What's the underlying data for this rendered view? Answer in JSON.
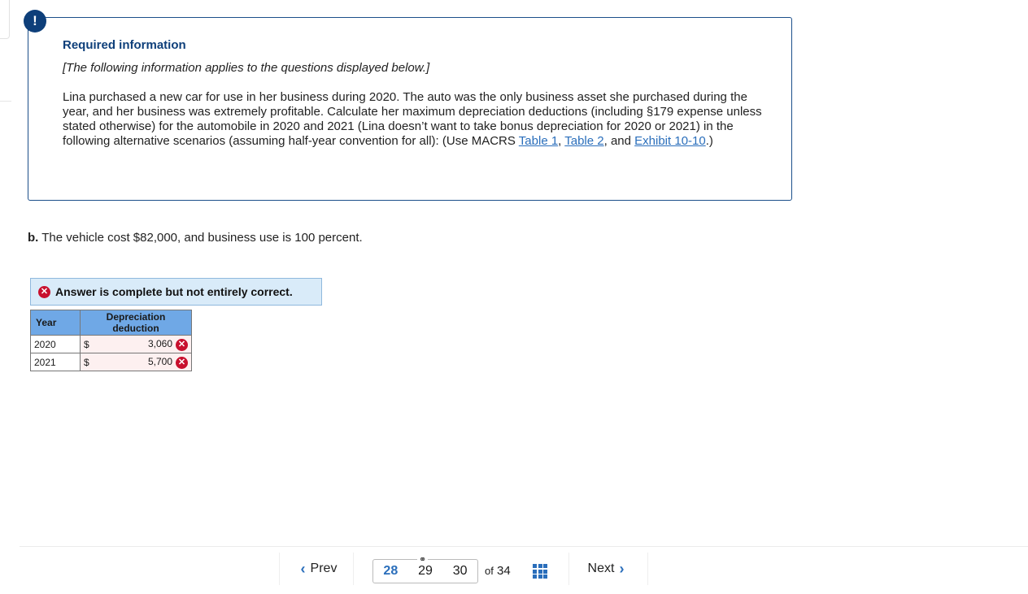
{
  "info": {
    "badge": "!",
    "title": "Required information",
    "subtitle": "[The following information applies to the questions displayed below.]",
    "body_text": "Lina purchased a new car for use in her business during 2020. The auto was the only business asset she purchased during the year, and her business was extremely profitable. Calculate her maximum depreciation deductions (including §179 expense unless stated otherwise) for the automobile in 2020 and 2021 (Lina doesn’t want to take bonus depreciation for 2020 or 2021) in the following alternative scenarios (assuming half-year convention for all): (Use MACRS ",
    "links": [
      "Table 1",
      "Table 2",
      "Exhibit 10-10"
    ],
    "sep1": ", ",
    "sep2": ", and ",
    "end": ".)"
  },
  "question": {
    "label": "b.",
    "text": " The vehicle cost $82,000, and business use is 100 percent."
  },
  "status": {
    "text": "Answer is complete but not entirely correct.",
    "color": "#c8102e"
  },
  "table": {
    "headers": [
      "Year",
      "Depreciation deduction"
    ],
    "rows": [
      {
        "year": "2020",
        "currency": "$",
        "value": "3,060",
        "correct": false
      },
      {
        "year": "2021",
        "currency": "$",
        "value": "5,700",
        "correct": false
      }
    ]
  },
  "pagination": {
    "prev_label": "Prev",
    "next_label": "Next",
    "pages": [
      "28",
      "29",
      "30"
    ],
    "current": "28",
    "of_label": "of",
    "total": "34"
  }
}
